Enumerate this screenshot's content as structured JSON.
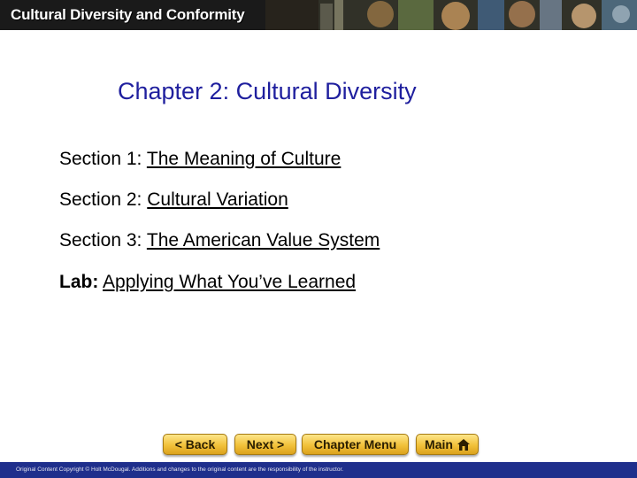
{
  "header": {
    "title": "Cultural Diversity and Conformity"
  },
  "slide": {
    "title": "Chapter 2: Cultural Diversity",
    "title_color": "#1f1f9e",
    "sections": [
      {
        "prefix": "Section 1:",
        "link": "The Meaning of Culture"
      },
      {
        "prefix": "Section 2:",
        "link": "Cultural Variation"
      },
      {
        "prefix": "Section 3:",
        "link": "The American Value System"
      },
      {
        "prefix": "Lab:",
        "link": "Applying What You’ve Learned"
      }
    ]
  },
  "nav": {
    "back_label": "< Back",
    "next_label": "Next >",
    "chapter_menu_label": "Chapter Menu",
    "main_label": "Main",
    "button_color": "#f2c13a"
  },
  "footer": {
    "text": "Original Content Copyright © Holt McDougal. Additions and changes to the original content are the responsibility of the instructor.",
    "background": "#1f2f8c"
  }
}
